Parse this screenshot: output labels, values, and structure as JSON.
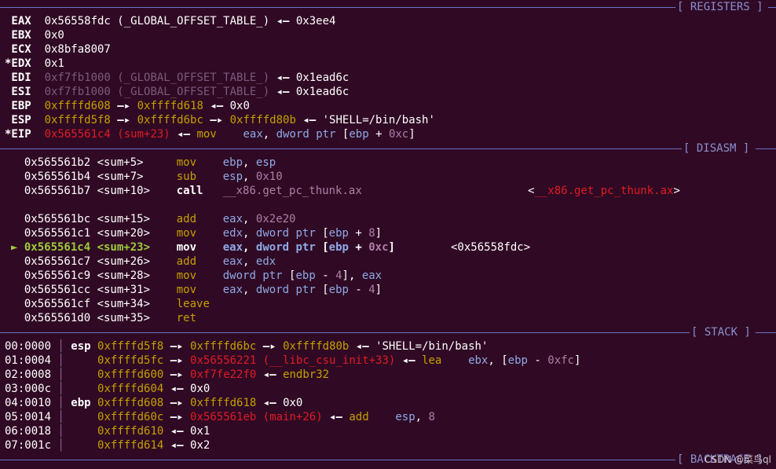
{
  "separators": {
    "registers": "[ REGISTERS ]",
    "disasm": "[ DISASM ]",
    "stack": "[ STACK ]",
    "backtrace": "[ BACKTRACE ]"
  },
  "registers": [
    {
      "mark": " ",
      "name": "EAX",
      "parts": [
        [
          "w",
          "0x56558fdc (_GLOBAL_OFFSET_TABLE_)"
        ],
        [
          "arrow",
          " ◂— "
        ],
        [
          "w",
          "0x3ee4"
        ]
      ]
    },
    {
      "mark": " ",
      "name": "EBX",
      "parts": [
        [
          "w",
          "0x0"
        ]
      ]
    },
    {
      "mark": " ",
      "name": "ECX",
      "parts": [
        [
          "w",
          "0x8bfa8007"
        ]
      ]
    },
    {
      "mark": "*",
      "name": "EDX",
      "parts": [
        [
          "w",
          "0x1"
        ]
      ]
    },
    {
      "mark": " ",
      "name": "EDI",
      "parts": [
        [
          "grey",
          "0xf7fb1000 (_GLOBAL_OFFSET_TABLE_)"
        ],
        [
          "arrow",
          " ◂— "
        ],
        [
          "w",
          "0x1ead6c"
        ]
      ]
    },
    {
      "mark": " ",
      "name": "ESI",
      "parts": [
        [
          "grey",
          "0xf7fb1000 (_GLOBAL_OFFSET_TABLE_)"
        ],
        [
          "arrow",
          " ◂— "
        ],
        [
          "w",
          "0x1ead6c"
        ]
      ]
    },
    {
      "mark": " ",
      "name": "EBP",
      "parts": [
        [
          "yel",
          "0xffffd608"
        ],
        [
          "arrow",
          " —▸ "
        ],
        [
          "yel",
          "0xffffd618"
        ],
        [
          "arrow",
          " ◂— "
        ],
        [
          "w",
          "0x0"
        ]
      ]
    },
    {
      "mark": " ",
      "name": "ESP",
      "parts": [
        [
          "yel",
          "0xffffd5f8"
        ],
        [
          "arrow",
          " —▸ "
        ],
        [
          "yel",
          "0xffffd6bc"
        ],
        [
          "arrow",
          " —▸ "
        ],
        [
          "yel",
          "0xffffd80b"
        ],
        [
          "arrow",
          " ◂— "
        ],
        [
          "w",
          "'SHELL=/bin/bash'"
        ]
      ]
    },
    {
      "mark": "*",
      "name": "EIP",
      "parts": [
        [
          "red",
          "0x565561c4 (sum+23)"
        ],
        [
          "arrow",
          " ◂— "
        ],
        [
          "mnem",
          "mov    "
        ],
        [
          "blu",
          "eax"
        ],
        [
          "w",
          ", "
        ],
        [
          "blu",
          "dword ptr "
        ],
        [
          "w",
          "["
        ],
        [
          "blu",
          "ebp"
        ],
        [
          "w",
          " + "
        ],
        [
          "pur",
          "0xc"
        ],
        [
          "w",
          "]"
        ]
      ]
    }
  ],
  "disasm": [
    {
      "cur": false,
      "addr": "0x565561b2",
      "sym": "<sum+5>",
      "mn": "mov",
      "ops": [
        [
          "blu",
          "ebp"
        ],
        [
          "w",
          ", "
        ],
        [
          "blu",
          "esp"
        ]
      ]
    },
    {
      "cur": false,
      "addr": "0x565561b4",
      "sym": "<sum+7>",
      "mn": "sub",
      "ops": [
        [
          "blu",
          "esp"
        ],
        [
          "w",
          ", "
        ],
        [
          "pur",
          "0x10"
        ]
      ]
    },
    {
      "cur": false,
      "addr": "0x565561b7",
      "sym": "<sum+10>",
      "mn": "call",
      "bold": true,
      "ops": [
        [
          "pur",
          "__x86.get_pc_thunk.ax"
        ]
      ],
      "extra": [
        [
          "w",
          "<"
        ],
        [
          "red",
          "__x86.get_pc_thunk.ax"
        ],
        [
          "w",
          ">"
        ]
      ]
    },
    {
      "blank": true
    },
    {
      "cur": false,
      "addr": "0x565561bc",
      "sym": "<sum+15>",
      "mn": "add",
      "ops": [
        [
          "blu",
          "eax"
        ],
        [
          "w",
          ", "
        ],
        [
          "pur",
          "0x2e20"
        ]
      ]
    },
    {
      "cur": false,
      "addr": "0x565561c1",
      "sym": "<sum+20>",
      "mn": "mov",
      "ops": [
        [
          "blu",
          "edx"
        ],
        [
          "w",
          ", "
        ],
        [
          "blu",
          "dword ptr "
        ],
        [
          "w",
          "["
        ],
        [
          "blu",
          "ebp"
        ],
        [
          "w",
          " + "
        ],
        [
          "pur",
          "8"
        ],
        [
          "w",
          "]"
        ]
      ]
    },
    {
      "cur": true,
      "marker": "►",
      "addr": "0x565561c4",
      "sym": "<sum+23>",
      "mn": "mov",
      "ops": [
        [
          "blu",
          "eax"
        ],
        [
          "w",
          ", "
        ],
        [
          "blu",
          "dword ptr "
        ],
        [
          "w",
          "["
        ],
        [
          "blu",
          "ebp"
        ],
        [
          "w",
          " + "
        ],
        [
          "pur",
          "0xc"
        ],
        [
          "w",
          "]"
        ]
      ],
      "extra": [
        [
          "w",
          "<0x56558fdc>"
        ]
      ]
    },
    {
      "cur": false,
      "addr": "0x565561c7",
      "sym": "<sum+26>",
      "mn": "add",
      "ops": [
        [
          "blu",
          "eax"
        ],
        [
          "w",
          ", "
        ],
        [
          "blu",
          "edx"
        ]
      ]
    },
    {
      "cur": false,
      "addr": "0x565561c9",
      "sym": "<sum+28>",
      "mn": "mov",
      "ops": [
        [
          "blu",
          "dword ptr "
        ],
        [
          "w",
          "["
        ],
        [
          "blu",
          "ebp"
        ],
        [
          "w",
          " - "
        ],
        [
          "pur",
          "4"
        ],
        [
          "w",
          "], "
        ],
        [
          "blu",
          "eax"
        ]
      ]
    },
    {
      "cur": false,
      "addr": "0x565561cc",
      "sym": "<sum+31>",
      "mn": "mov",
      "ops": [
        [
          "blu",
          "eax"
        ],
        [
          "w",
          ", "
        ],
        [
          "blu",
          "dword ptr "
        ],
        [
          "w",
          "["
        ],
        [
          "blu",
          "ebp"
        ],
        [
          "w",
          " - "
        ],
        [
          "pur",
          "4"
        ],
        [
          "w",
          "]"
        ]
      ]
    },
    {
      "cur": false,
      "addr": "0x565561cf",
      "sym": "<sum+34>",
      "mn": "leave",
      "ops": []
    },
    {
      "cur": false,
      "addr": "0x565561d0",
      "sym": "<sum+35>",
      "mn": "ret",
      "ops": []
    }
  ],
  "stack": [
    {
      "idx": "00:0000",
      "reg": "esp",
      "parts": [
        [
          "yel",
          "0xffffd5f8"
        ],
        [
          "arrow",
          " —▸ "
        ],
        [
          "yel",
          "0xffffd6bc"
        ],
        [
          "arrow",
          " —▸ "
        ],
        [
          "yel",
          "0xffffd80b"
        ],
        [
          "arrow",
          " ◂— "
        ],
        [
          "w",
          "'SHELL=/bin/bash'"
        ]
      ]
    },
    {
      "idx": "01:0004",
      "reg": "",
      "parts": [
        [
          "yel",
          "0xffffd5fc"
        ],
        [
          "arrow",
          " —▸ "
        ],
        [
          "red",
          "0x56556221 (__libc_csu_init+33)"
        ],
        [
          "arrow",
          " ◂— "
        ],
        [
          "mnem",
          "lea    "
        ],
        [
          "blu",
          "ebx"
        ],
        [
          "w",
          ", ["
        ],
        [
          "blu",
          "ebp"
        ],
        [
          "w",
          " - "
        ],
        [
          "pur",
          "0xfc"
        ],
        [
          "w",
          "]"
        ]
      ]
    },
    {
      "idx": "02:0008",
      "reg": "",
      "parts": [
        [
          "yel",
          "0xffffd600"
        ],
        [
          "arrow",
          " —▸ "
        ],
        [
          "red",
          "0xf7fe22f0"
        ],
        [
          "arrow",
          " ◂— "
        ],
        [
          "mnem",
          "endbr32"
        ]
      ]
    },
    {
      "idx": "03:000c",
      "reg": "",
      "parts": [
        [
          "yel",
          "0xffffd604"
        ],
        [
          "arrow",
          " ◂— "
        ],
        [
          "w",
          "0x0"
        ]
      ]
    },
    {
      "idx": "04:0010",
      "reg": "ebp",
      "parts": [
        [
          "yel",
          "0xffffd608"
        ],
        [
          "arrow",
          " —▸ "
        ],
        [
          "yel",
          "0xffffd618"
        ],
        [
          "arrow",
          " ◂— "
        ],
        [
          "w",
          "0x0"
        ]
      ]
    },
    {
      "idx": "05:0014",
      "reg": "",
      "parts": [
        [
          "yel",
          "0xffffd60c"
        ],
        [
          "arrow",
          " —▸ "
        ],
        [
          "red",
          "0x565561eb (main+26)"
        ],
        [
          "arrow",
          " ◂— "
        ],
        [
          "mnem",
          "add    "
        ],
        [
          "blu",
          "esp"
        ],
        [
          "w",
          ", "
        ],
        [
          "pur",
          "8"
        ]
      ]
    },
    {
      "idx": "06:0018",
      "reg": "",
      "parts": [
        [
          "yel",
          "0xffffd610"
        ],
        [
          "arrow",
          " ◂— "
        ],
        [
          "w",
          "0x1"
        ]
      ]
    },
    {
      "idx": "07:001c",
      "reg": "",
      "parts": [
        [
          "yel",
          "0xffffd614"
        ],
        [
          "arrow",
          " ◂— "
        ],
        [
          "w",
          "0x2"
        ]
      ]
    }
  ],
  "watermark": "CSDN @菜鸟ql"
}
